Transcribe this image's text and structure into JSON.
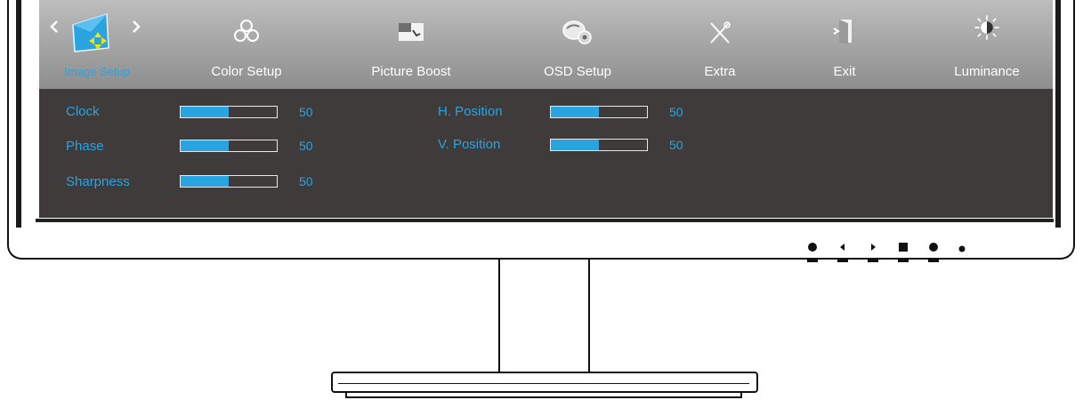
{
  "osd": {
    "tabs": [
      {
        "label": "Image Setup",
        "icon": "image-setup-icon",
        "active": true
      },
      {
        "label": "Color Setup",
        "icon": "color-setup-icon",
        "active": false
      },
      {
        "label": "Picture Boost",
        "icon": "picture-boost-icon",
        "active": false
      },
      {
        "label": "OSD Setup",
        "icon": "osd-setup-icon",
        "active": false
      },
      {
        "label": "Extra",
        "icon": "extra-icon",
        "active": false
      },
      {
        "label": "Exit",
        "icon": "exit-icon",
        "active": false
      },
      {
        "label": "Luminance",
        "icon": "luminance-icon",
        "active": false
      }
    ],
    "settings": [
      {
        "label": "Clock",
        "value": "50",
        "level": 0.5
      },
      {
        "label": "Phase",
        "value": "50",
        "level": 0.5
      },
      {
        "label": "Sharpness",
        "value": "50",
        "level": 0.5
      },
      {
        "label": "H. Position",
        "value": "50",
        "level": 0.5
      },
      {
        "label": "V. Position",
        "value": "50",
        "level": 0.5
      }
    ]
  },
  "colors": {
    "accent": "#2aa3e1",
    "panel": "#3f3b3a",
    "tabbar": "#a8a8a8"
  },
  "hardware_buttons": [
    "power-button",
    "left-button",
    "right-button",
    "menu-button",
    "auto-button",
    "power-led"
  ]
}
